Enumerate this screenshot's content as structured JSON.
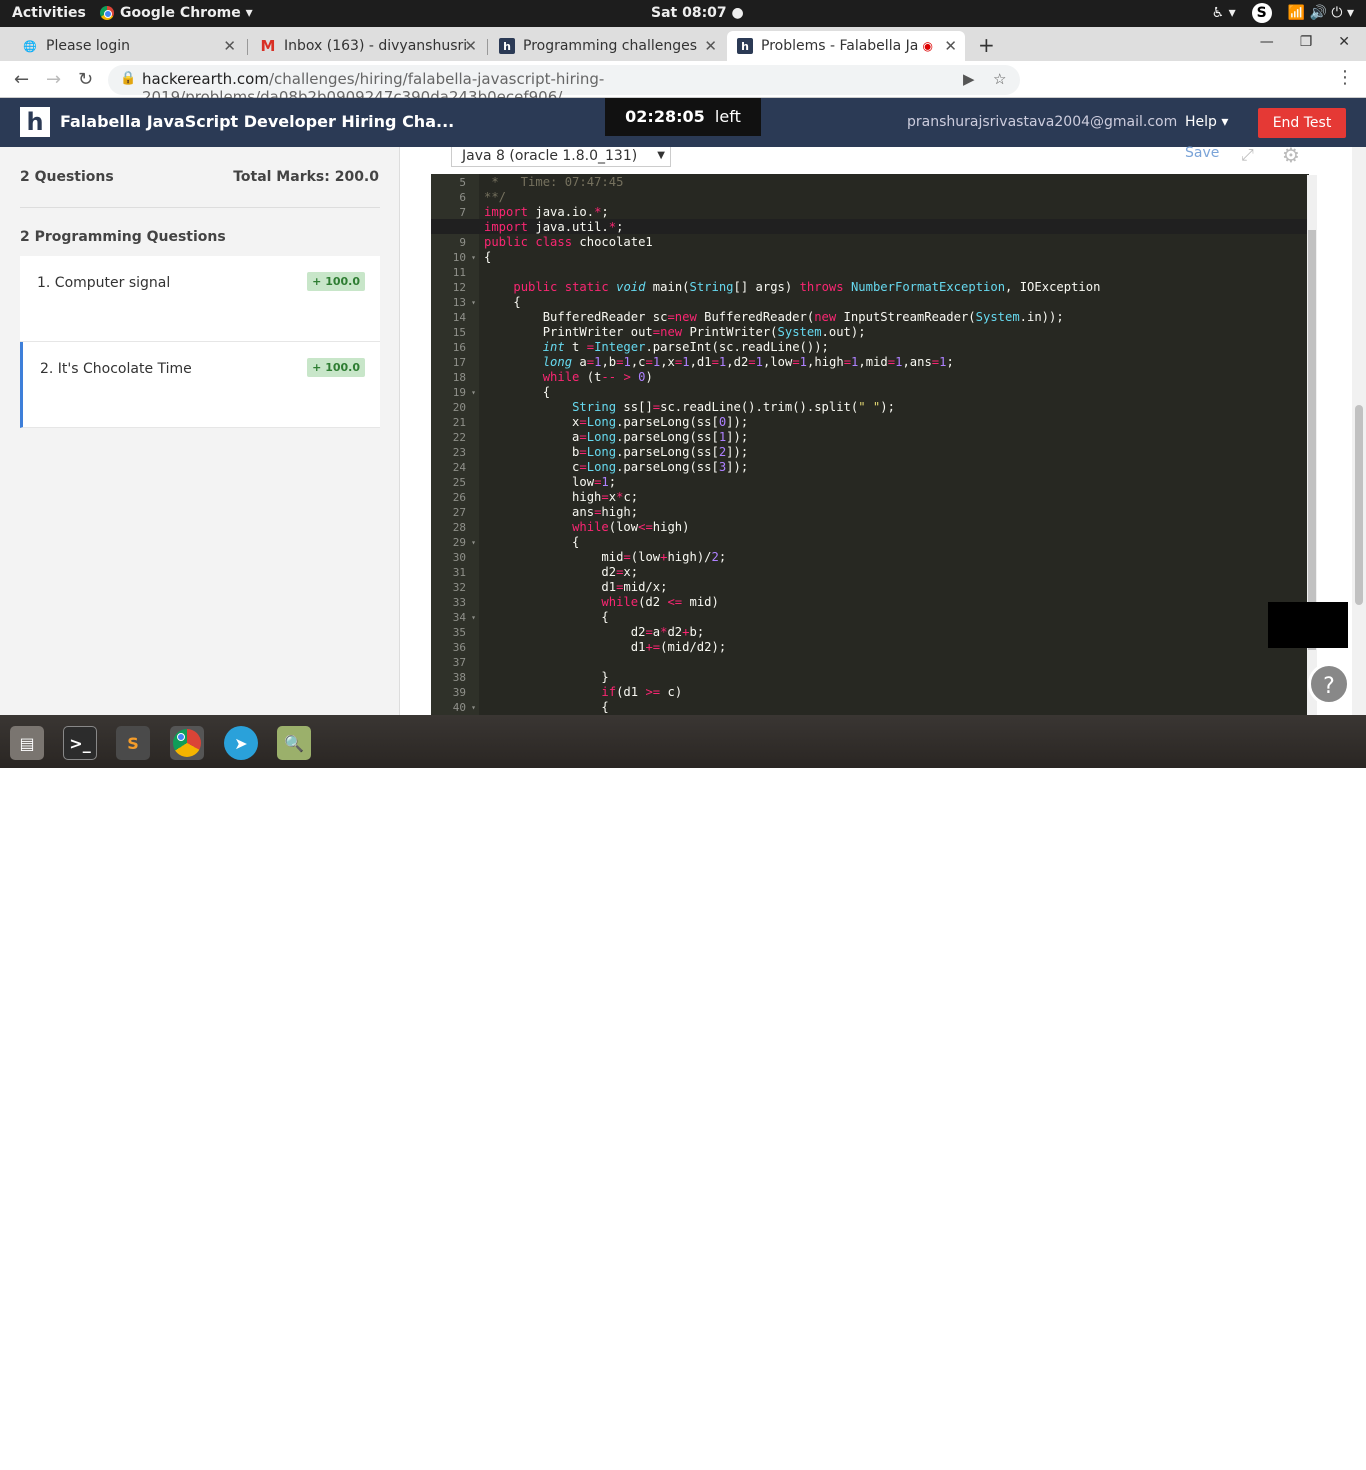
{
  "system": {
    "activities": "Activities",
    "app": "Google Chrome ▾",
    "clock": "Sat 08:07 ●",
    "tray": [
      "♿ ▾",
      "S",
      "📶 🔊 ⏻ ▾"
    ]
  },
  "tabs": [
    {
      "title": "Please login"
    },
    {
      "title": "Inbox (163) - divyanshusri"
    },
    {
      "title": "Programming challenges"
    },
    {
      "title": "Problems - Falabella Ja"
    }
  ],
  "new_tab": "+",
  "window": {
    "min": "—",
    "max": "❐",
    "close": "✕"
  },
  "address": {
    "domain": "hackerearth.com",
    "path": "/challenges/hiring/falabella-javascript-hiring-2019/problems/da08b2b0909247c390da243b0ecef906/"
  },
  "header": {
    "logo": "h",
    "title": "Falabella JavaScript Developer Hiring Cha...",
    "timer_value": "02:28:05",
    "timer_suffix": "left",
    "email": "pranshurajsrivastava2004@gmail.com",
    "help": "Help ▾",
    "end_test": "End Test"
  },
  "sidebar": {
    "questions_count": "2 Questions",
    "total_marks": "Total Marks: 200.0",
    "programming_header": "2 Programming Questions",
    "questions": [
      {
        "title": "1. Computer signal",
        "badge": "+ 100.0"
      },
      {
        "title": "2. It's Chocolate Time",
        "badge": "+ 100.0"
      }
    ]
  },
  "editor": {
    "language": "Java 8 (oracle 1.8.0_131)",
    "save": "Save",
    "lines": [
      {
        "n": "5",
        "fold": false,
        "text": " *   Time: 07:47:45"
      },
      {
        "n": "6",
        "fold": false,
        "text": "**/"
      },
      {
        "n": "7",
        "fold": false,
        "text": "import java.io.*;"
      },
      {
        "n": "8",
        "fold": false,
        "text": "import java.util.*;"
      },
      {
        "n": "9",
        "fold": false,
        "text": "public class chocolate1"
      },
      {
        "n": "10",
        "fold": true,
        "text": "{"
      },
      {
        "n": "11",
        "fold": false,
        "text": ""
      },
      {
        "n": "12",
        "fold": false,
        "text": "    public static void main(String[] args) throws NumberFormatException, IOException"
      },
      {
        "n": "13",
        "fold": true,
        "text": "    {"
      },
      {
        "n": "14",
        "fold": false,
        "text": "        BufferedReader sc=new BufferedReader(new InputStreamReader(System.in));"
      },
      {
        "n": "15",
        "fold": false,
        "text": "        PrintWriter out=new PrintWriter(System.out);"
      },
      {
        "n": "16",
        "fold": false,
        "text": "        int t =Integer.parseInt(sc.readLine());"
      },
      {
        "n": "17",
        "fold": false,
        "text": "        long a=1,b=1,c=1,x=1,d1=1,d2=1,low=1,high=1,mid=1,ans=1;"
      },
      {
        "n": "18",
        "fold": false,
        "text": "        while (t-- > 0)"
      },
      {
        "n": "19",
        "fold": true,
        "text": "        {"
      },
      {
        "n": "20",
        "fold": false,
        "text": "            String ss[]=sc.readLine().trim().split(\" \");"
      },
      {
        "n": "21",
        "fold": false,
        "text": "            x=Long.parseLong(ss[0]);"
      },
      {
        "n": "22",
        "fold": false,
        "text": "            a=Long.parseLong(ss[1]);"
      },
      {
        "n": "23",
        "fold": false,
        "text": "            b=Long.parseLong(ss[2]);"
      },
      {
        "n": "24",
        "fold": false,
        "text": "            c=Long.parseLong(ss[3]);"
      },
      {
        "n": "25",
        "fold": false,
        "text": "            low=1;"
      },
      {
        "n": "26",
        "fold": false,
        "text": "            high=x*c;"
      },
      {
        "n": "27",
        "fold": false,
        "text": "            ans=high;"
      },
      {
        "n": "28",
        "fold": false,
        "text": "            while(low<=high)"
      },
      {
        "n": "29",
        "fold": true,
        "text": "            {"
      },
      {
        "n": "30",
        "fold": false,
        "text": "                mid=(low+high)/2;"
      },
      {
        "n": "31",
        "fold": false,
        "text": "                d2=x;"
      },
      {
        "n": "32",
        "fold": false,
        "text": "                d1=mid/x;"
      },
      {
        "n": "33",
        "fold": false,
        "text": "                while(d2 <= mid)"
      },
      {
        "n": "34",
        "fold": true,
        "text": "                {"
      },
      {
        "n": "35",
        "fold": false,
        "text": "                    d2=a*d2+b;"
      },
      {
        "n": "36",
        "fold": false,
        "text": "                    d1+=(mid/d2);"
      },
      {
        "n": "37",
        "fold": false,
        "text": ""
      },
      {
        "n": "38",
        "fold": false,
        "text": "                }"
      },
      {
        "n": "39",
        "fold": false,
        "text": "                if(d1 >= c)"
      },
      {
        "n": "40",
        "fold": true,
        "text": "                {"
      }
    ]
  },
  "help_fab": "?",
  "dock": [
    {
      "name": "files-icon"
    },
    {
      "name": "terminal-icon"
    },
    {
      "name": "sublime-text-icon"
    },
    {
      "name": "chrome-icon"
    },
    {
      "name": "telegram-icon"
    },
    {
      "name": "image-viewer-icon"
    }
  ],
  "colors": {
    "header_bg": "#2b3a55",
    "end_test": "#e53935",
    "editor_bg": "#272822",
    "keyword": "#f92672",
    "type": "#66d9ef",
    "number": "#ae81ff",
    "string": "#e6db74"
  }
}
